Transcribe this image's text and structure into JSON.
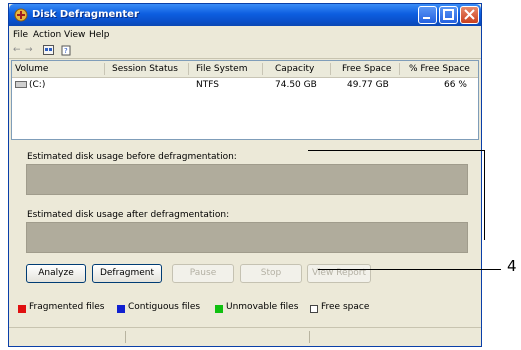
{
  "window": {
    "title": "Disk Defragmenter"
  },
  "menu": [
    "File",
    "Action",
    "View",
    "Help"
  ],
  "toolbar": {
    "back": "←",
    "forward": "→"
  },
  "volumes": {
    "columns": [
      "Volume",
      "Session Status",
      "File System",
      "Capacity",
      "Free Space",
      "% Free Space"
    ],
    "rows": [
      {
        "volume": "(C:)",
        "status": "",
        "fs": "NTFS",
        "capacity": "74.50 GB",
        "free": "49.77 GB",
        "pct": "66 %"
      }
    ]
  },
  "labels": {
    "before": "Estimated disk usage before defragmentation:",
    "after": "Estimated disk usage after defragmentation:"
  },
  "buttons": {
    "analyze": "Analyze",
    "defragment": "Defragment",
    "pause": "Pause",
    "stop": "Stop",
    "view_report": "View Report"
  },
  "legend": [
    {
      "label": "Fragmented files",
      "color": "#e01010"
    },
    {
      "label": "Contiguous files",
      "color": "#1020d0"
    },
    {
      "label": "Unmovable files",
      "color": "#10c010"
    },
    {
      "label": "Free space",
      "color": "#ffffff"
    }
  ],
  "callout": {
    "label": "4"
  }
}
